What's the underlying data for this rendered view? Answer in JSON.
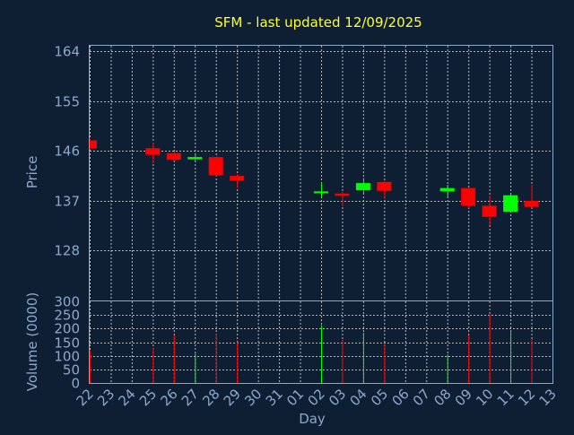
{
  "chart_data": {
    "type": "candlestick",
    "title": "SFM - last updated 12/09/2025",
    "xlabel": "Day",
    "x_ticks": [
      "22",
      "23",
      "24",
      "25",
      "26",
      "27",
      "28",
      "29",
      "30",
      "31",
      "01",
      "02",
      "03",
      "04",
      "05",
      "06",
      "07",
      "08",
      "09",
      "10",
      "11",
      "12",
      "13"
    ],
    "price": {
      "ylabel": "Price",
      "y_ticks": [
        128,
        137,
        146,
        155,
        164
      ],
      "ylim": [
        119,
        165
      ],
      "grid": true
    },
    "volume": {
      "ylabel": "Volume (0000)",
      "y_ticks": [
        0,
        50,
        100,
        150,
        200,
        250,
        300
      ],
      "ylim": [
        0,
        300
      ],
      "grid": true
    },
    "colors": {
      "up": "#00ff00",
      "down": "#ff0000",
      "background": "#0f1f33",
      "title": "#ffff33",
      "axis": "#8aa9cf"
    },
    "candles": [
      {
        "day": "22",
        "open": 147.9,
        "high": 148.2,
        "low": 146.3,
        "close": 146.5,
        "volume": 120
      },
      {
        "day": "25",
        "open": 146.5,
        "high": 147.5,
        "low": 143.8,
        "close": 145.3,
        "volume": 130
      },
      {
        "day": "26",
        "open": 145.6,
        "high": 145.9,
        "low": 144.2,
        "close": 144.4,
        "volume": 175
      },
      {
        "day": "27",
        "open": 144.5,
        "high": 145.6,
        "low": 144.1,
        "close": 144.9,
        "volume": 108
      },
      {
        "day": "28",
        "open": 144.9,
        "high": 145.0,
        "low": 141.4,
        "close": 141.6,
        "volume": 182
      },
      {
        "day": "29",
        "open": 141.5,
        "high": 141.8,
        "low": 139.4,
        "close": 140.6,
        "volume": 150
      },
      {
        "day": "02",
        "open": 138.4,
        "high": 140.2,
        "low": 137.8,
        "close": 138.7,
        "volume": 212
      },
      {
        "day": "03",
        "open": 138.3,
        "high": 138.6,
        "low": 136.0,
        "close": 137.9,
        "volume": 160
      },
      {
        "day": "04",
        "open": 138.9,
        "high": 141.1,
        "low": 138.4,
        "close": 140.2,
        "volume": 185
      },
      {
        "day": "05",
        "open": 140.4,
        "high": 140.6,
        "low": 137.3,
        "close": 138.8,
        "volume": 140
      },
      {
        "day": "08",
        "open": 138.7,
        "high": 139.9,
        "low": 137.7,
        "close": 139.3,
        "volume": 105
      },
      {
        "day": "09",
        "open": 139.3,
        "high": 139.4,
        "low": 135.7,
        "close": 136.1,
        "volume": 175
      },
      {
        "day": "10",
        "open": 136.1,
        "high": 137.9,
        "low": 132.6,
        "close": 134.1,
        "volume": 255
      },
      {
        "day": "11",
        "open": 135.0,
        "high": 138.1,
        "low": 134.9,
        "close": 138.0,
        "volume": 195
      },
      {
        "day": "12",
        "open": 137.0,
        "high": 139.9,
        "low": 135.8,
        "close": 135.9,
        "volume": 160
      }
    ]
  }
}
